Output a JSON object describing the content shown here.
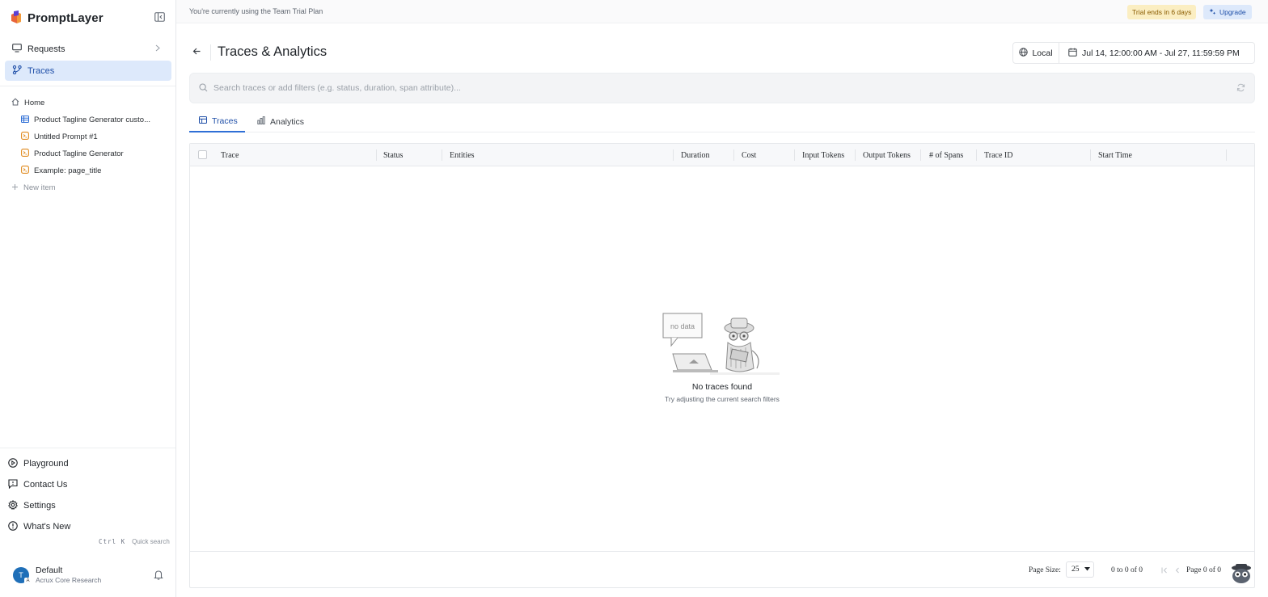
{
  "sidebar": {
    "brand": "PromptLayer",
    "nav": [
      {
        "label": "Requests",
        "icon": "monitor-icon"
      },
      {
        "label": "Traces",
        "icon": "traces-icon"
      }
    ],
    "tree": {
      "home": "Home",
      "items": [
        {
          "label": "Product Tagline Generator custo...",
          "icon": "dataset-icon"
        },
        {
          "label": "Untitled Prompt #1",
          "icon": "prompt-icon"
        },
        {
          "label": "Product Tagline Generator",
          "icon": "prompt-icon"
        },
        {
          "label": "Example: page_title",
          "icon": "prompt-icon"
        }
      ],
      "new_item": "New item"
    },
    "bottom": [
      {
        "label": "Playground",
        "icon": "play-icon"
      },
      {
        "label": "Contact Us",
        "icon": "message-icon"
      },
      {
        "label": "Settings",
        "icon": "gear-icon"
      },
      {
        "label": "What's New",
        "icon": "info-icon"
      }
    ],
    "quick_search": {
      "kbd": "Ctrl K",
      "label": "Quick search"
    },
    "user": {
      "initial": "T",
      "badge": "A",
      "name": "Default",
      "org": "Acrux Core Research"
    }
  },
  "banner": {
    "text": "You're currently using the Team Trial Plan",
    "trial": "Trial ends in 6 days",
    "upgrade": "Upgrade"
  },
  "header": {
    "title": "Traces & Analytics",
    "timezone": "Local",
    "date_range": "Jul 14, 12:00:00 AM - Jul 27, 11:59:59 PM"
  },
  "search": {
    "placeholder": "Search traces or add filters (e.g. status, duration, span attribute)..."
  },
  "tabs": [
    {
      "label": "Traces",
      "active": true
    },
    {
      "label": "Analytics",
      "active": false
    }
  ],
  "table": {
    "columns": [
      "Trace",
      "Status",
      "Entities",
      "Duration",
      "Cost",
      "Input Tokens",
      "Output Tokens",
      "# of Spans",
      "Trace ID",
      "Start Time"
    ],
    "empty": {
      "illustration_text": "no data",
      "title": "No traces found",
      "subtitle": "Try adjusting the current search filters"
    },
    "footer": {
      "page_size_label": "Page Size:",
      "page_size": "25",
      "range": "0 to 0 of 0",
      "page": "Page 0 of 0"
    }
  },
  "colors": {
    "accent": "#2f6fd6",
    "active_bg": "#dde9fb",
    "trial_bg": "#fbeec2"
  }
}
